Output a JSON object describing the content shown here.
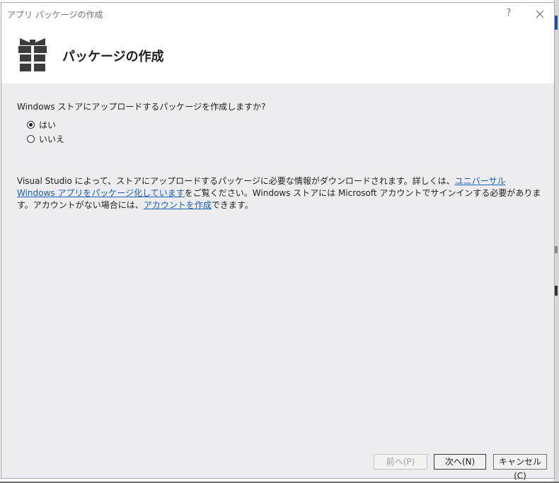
{
  "window": {
    "title": "アプリ パッケージの作成",
    "help_label": "?"
  },
  "header": {
    "title": "パッケージの作成",
    "icon": "gift-package-icon"
  },
  "question": {
    "text": "Windows ストアにアップロードするパッケージを作成しますか?",
    "options": [
      {
        "label": "はい",
        "selected": true
      },
      {
        "label": "いいえ",
        "selected": false
      }
    ]
  },
  "info": {
    "part1": "Visual Studio によって、ストアにアップロードするパッケージに必要な情報がダウンロードされます。詳しくは、",
    "link1": "ユニバーサル Windows アプリをパッケージ化しています",
    "part2": "をご覧ください。Windows ストアには Microsoft アカウントでサインインする必要があります。アカウントがない場合には、",
    "link2": "アカウントを作成",
    "part3": "できます。"
  },
  "buttons": {
    "back": "前へ(P)",
    "next": "次へ(N)",
    "cancel": "キャンセル(C)"
  },
  "colors": {
    "dialog_background": "#ededf1",
    "link": "#1a5fb4",
    "edge_accent": "#1f4fa8"
  }
}
